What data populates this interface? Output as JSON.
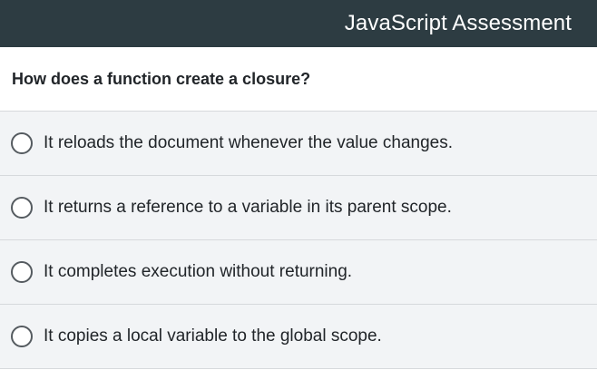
{
  "header": {
    "title": "JavaScript Assessment"
  },
  "question": {
    "text": "How does a function create a closure?"
  },
  "options": [
    {
      "label": "It reloads the document whenever the value changes.",
      "selected": false
    },
    {
      "label": "It returns a reference to a variable in its parent scope.",
      "selected": false
    },
    {
      "label": "It completes execution without returning.",
      "selected": false
    },
    {
      "label": "It copies a local variable to the global scope.",
      "selected": false
    }
  ],
  "colors": {
    "header_bg": "#2d3c42",
    "option_bg": "#f2f4f6",
    "divider": "#d6d9dc"
  }
}
